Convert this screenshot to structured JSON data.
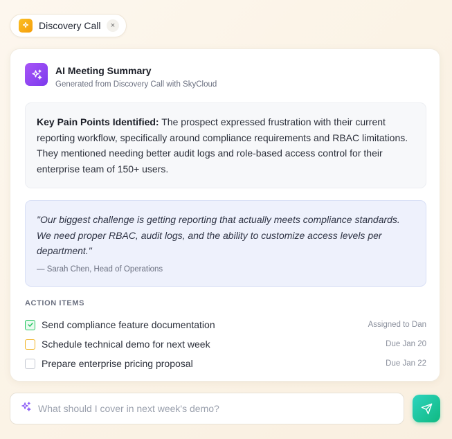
{
  "tab": {
    "label": "Discovery Call",
    "close": "×"
  },
  "summary": {
    "title": "AI Meeting Summary",
    "subtitle": "Generated from Discovery Call with SkyCloud"
  },
  "pain_points": {
    "label": "Key Pain Points Identified:",
    "text": " The prospect expressed frustration with their current reporting workflow, specifically around compliance requirements and RBAC limitations. They mentioned needing better audit logs and role-based access control for their enterprise team of 150+ users."
  },
  "quote": {
    "text": "\"Our biggest challenge is getting reporting that actually meets compliance standards. We need proper RBAC, audit logs, and the ability to customize access levels per department.\"",
    "author": "— Sarah Chen, Head of Operations"
  },
  "actions": {
    "heading": "ACTION ITEMS",
    "items": [
      {
        "label": "Send compliance feature documentation",
        "meta": "Assigned to Dan",
        "state": "done"
      },
      {
        "label": "Schedule technical demo for next week",
        "meta": "Due Jan 20",
        "state": "pending"
      },
      {
        "label": "Prepare enterprise pricing proposal",
        "meta": "Due Jan 22",
        "state": "open"
      }
    ]
  },
  "input": {
    "placeholder": "What should I cover in next week's demo?"
  },
  "colors": {
    "accent_purple": "#7c3aed",
    "accent_green": "#10b981",
    "accent_amber": "#f59e0b"
  },
  "icons": {
    "tab": "sparkle-icon",
    "ai": "sparkle-icon",
    "input": "sparkle-icon",
    "send": "send-icon",
    "check": "check-icon"
  }
}
